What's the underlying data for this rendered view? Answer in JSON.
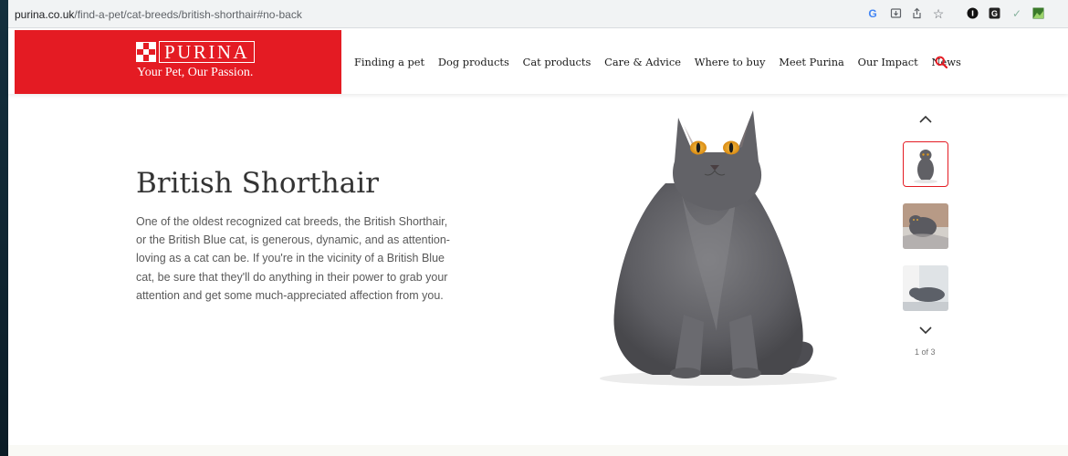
{
  "browser": {
    "url_host": "purina.co.uk",
    "url_path": "/find-a-pet/cat-breeds/british-shorthair#no-back",
    "extensions": [
      "google-icon",
      "install-icon",
      "share-icon",
      "star-icon",
      "onepassword-icon",
      "grammarly-icon",
      "check-icon",
      "image-ext-icon"
    ]
  },
  "header": {
    "brand": "PURINA",
    "tagline": "Your Pet, Our Passion.",
    "nav": [
      {
        "label": "Finding a pet"
      },
      {
        "label": "Dog products"
      },
      {
        "label": "Cat products"
      },
      {
        "label": "Care & Advice"
      },
      {
        "label": "Where to buy"
      },
      {
        "label": "Meet Purina"
      },
      {
        "label": "Our Impact"
      },
      {
        "label": "News"
      }
    ],
    "brand_color": "#e41b23"
  },
  "hero": {
    "title": "British Shorthair",
    "description": "One of the oldest recognized cat breeds, the British Shorthair, or the British Blue cat, is generous, dynamic, and as attention-loving as a cat can be. If you're in the vicinity of a British Blue cat, be sure that they'll do anything in their power to grab your attention and get some much-appreciated affection from you."
  },
  "gallery": {
    "counter": "1 of 3",
    "active_index": 0,
    "thumbnails": [
      "thumb-cat-sitting",
      "thumb-cat-on-blanket",
      "thumb-cat-lying"
    ]
  }
}
